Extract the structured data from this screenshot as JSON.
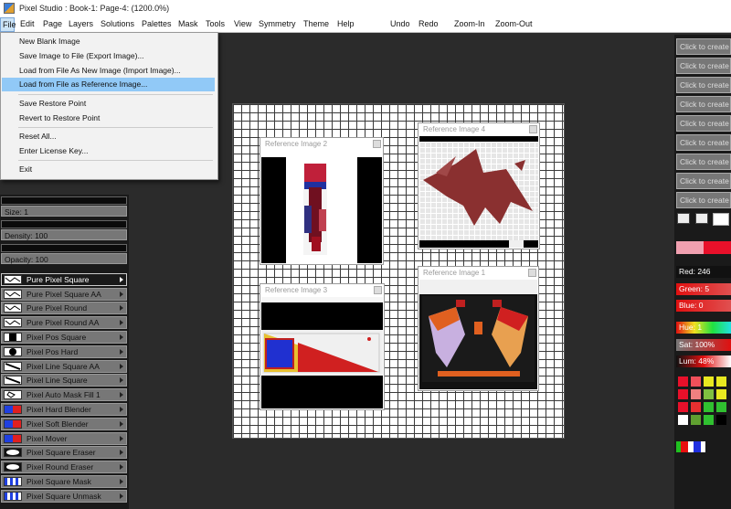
{
  "window": {
    "title": "Pixel Studio : Book-1: Page-4:  (1200.0%)"
  },
  "menubar": {
    "items": [
      "File",
      "Edit",
      "Page",
      "Layers",
      "Solutions",
      "Palettes",
      "Mask",
      "Tools",
      "View",
      "Symmetry",
      "Theme",
      "Help",
      "Undo",
      "Redo",
      "Zoom-In",
      "Zoom-Out"
    ]
  },
  "file_menu": {
    "items": [
      "New Blank Image",
      "Save Image to File (Export Image)...",
      "Load from File As New Image (Import Image)...",
      "Load from File as Reference Image...",
      "Save Restore Point",
      "Revert to Restore Point",
      "Reset All...",
      "Enter License Key...",
      "Exit"
    ],
    "highlighted_index": 3
  },
  "brush": {
    "size_label": "Size: 1",
    "density_label": "Density: 100",
    "opacity_label": "Opacity: 100"
  },
  "tools": [
    "Pure Pixel Square",
    "Pure Pixel Square AA",
    "Pure Pixel Round",
    "Pure Pixel Round AA",
    "Pixel Pos Square",
    "Pixel Pos Hard",
    "Pixel Line Square AA",
    "Pixel Line Square",
    "Pixel Auto Mask Fill 1",
    "Pixel Hard Blender",
    "Pixel Soft Blender",
    "Pixel Mover",
    "Pixel Square Eraser",
    "Pixel Round Eraser",
    "Pixel Square Mask",
    "Pixel Square Unmask"
  ],
  "selected_tool_index": 0,
  "reference_windows": [
    {
      "title": "Reference Image 2"
    },
    {
      "title": "Reference Image 4"
    },
    {
      "title": "Reference Image 3"
    },
    {
      "title": "Reference Image 1"
    }
  ],
  "right_panel": {
    "create_buttons": [
      "Click to create",
      "Click to create",
      "Click to create",
      "Click to create",
      "Click to create",
      "Click to create",
      "Click to create",
      "Click to create",
      "Click to create"
    ],
    "red_label": "Red: 246",
    "green_label": "Green: 5",
    "blue_label": "Blue: 0",
    "hue_label": "Hue: 1",
    "sat_label": "Sat: 100%",
    "lum_label": "Lum: 48%"
  },
  "colors": {
    "current_color": "#f60500",
    "menu_highlight": "#91c9f7",
    "palette": [
      "#e8102a",
      "#f0505a",
      "#e8e820",
      "#e8e820",
      "#e8102a",
      "#f08080",
      "#80c040",
      "#e8e820",
      "#e8102a",
      "#e83030",
      "#30c030",
      "#30c030",
      "#ffffff",
      "#60a030",
      "#30c030",
      "#000000"
    ],
    "recent": [
      "#20c020",
      "#e81010",
      "#ffffff",
      "#2030e0",
      "#ffffff"
    ]
  }
}
